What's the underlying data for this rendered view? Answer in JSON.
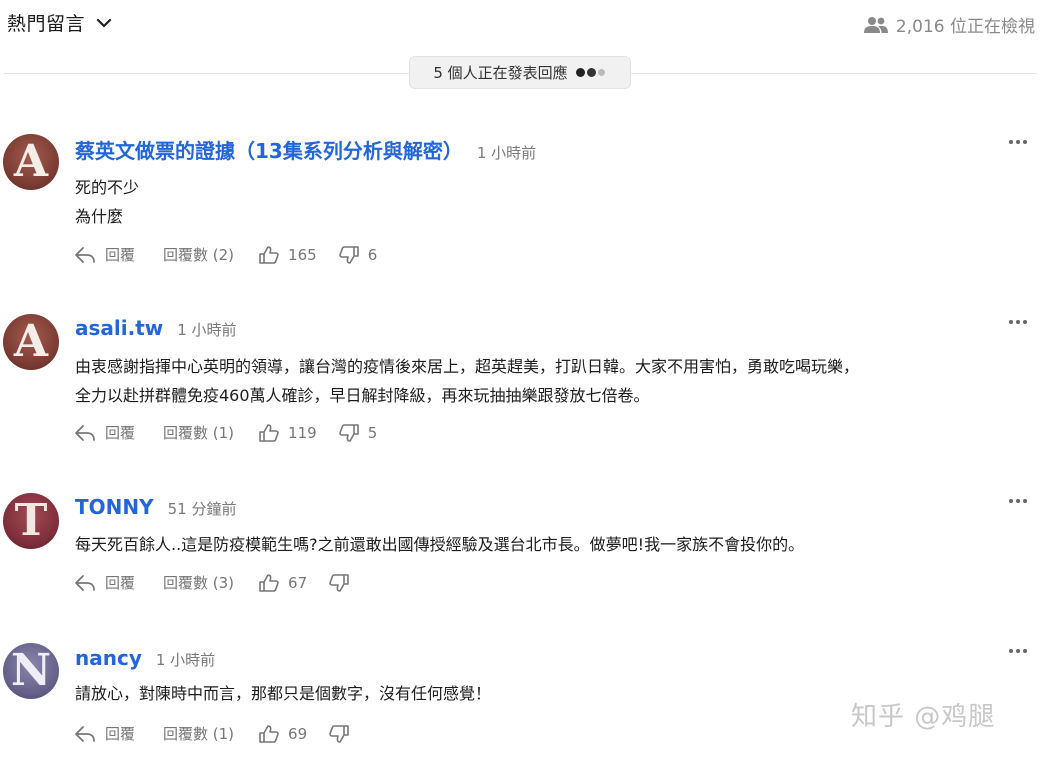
{
  "header": {
    "sort_label": "熱門留言",
    "viewers_text": "2,016 位正在檢視"
  },
  "typing_indicator": {
    "text": "5 個人正在發表回應"
  },
  "comments": [
    {
      "username": "蔡英文做票的證據（13集系列分析與解密）",
      "time": "1 小時前",
      "avatar_letter": "A",
      "lines": [
        "死的不少",
        "為什麼"
      ],
      "reply_label": "回覆",
      "replies_label": "回覆數 (2)",
      "likes": "165",
      "dislikes": "6"
    },
    {
      "username": "asali.tw",
      "time": "1 小時前",
      "avatar_letter": "A",
      "lines": [
        "由衷感謝指揮中心英明的領導，讓台灣的疫情後來居上，超英趕美，打趴日韓。大家不用害怕，勇敢吃喝玩樂，",
        "全力以赴拼群體免疫460萬人確診，早日解封降級，再來玩抽抽樂跟發放七倍卷。"
      ],
      "reply_label": "回覆",
      "replies_label": "回覆數 (1)",
      "likes": "119",
      "dislikes": "5"
    },
    {
      "username": "TONNY",
      "time": "51 分鐘前",
      "avatar_letter": "T",
      "lines": [
        "每天死百餘人..這是防疫模範生嗎?之前還敢出國傳授經驗及選台北市長。做夢吧!我一家族不會投你的。"
      ],
      "reply_label": "回覆",
      "replies_label": "回覆數 (3)",
      "likes": "67",
      "dislikes": ""
    },
    {
      "username": "nancy",
      "time": "1 小時前",
      "avatar_letter": "N",
      "lines": [
        "請放心，對陳時中而言，那都只是個數字，沒有任何感覺！"
      ],
      "reply_label": "回覆",
      "replies_label": "回覆數 (1)",
      "likes": "69",
      "dislikes": ""
    }
  ],
  "watermark": "知乎 @鸡腿",
  "colors": {
    "username": "#2266d9",
    "muted": "#777777",
    "divider": "#e6e6e6",
    "avatar_a": "#8b4a3f",
    "avatar_t": "#8a3a45",
    "avatar_n": "#6f6a8e"
  },
  "icons": {
    "sort": "chevron-down-icon",
    "viewers": "people-icon",
    "reply": "reply-arrow-icon",
    "like": "thumbs-up-icon",
    "dislike": "thumbs-down-icon",
    "more": "more-dots-icon"
  }
}
